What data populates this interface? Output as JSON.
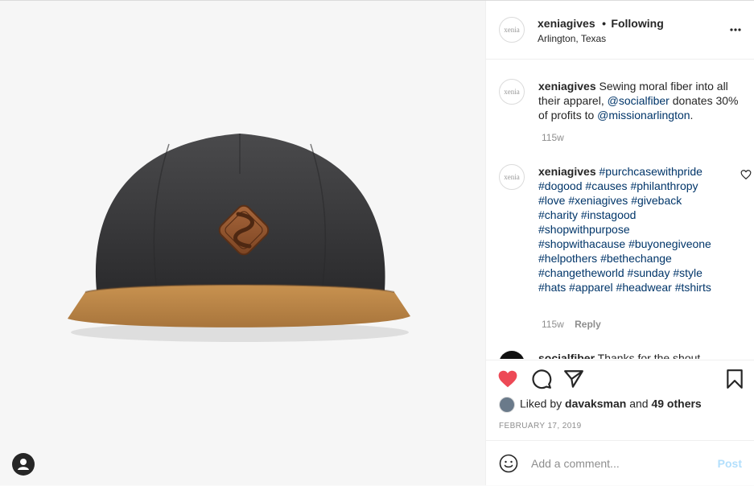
{
  "header": {
    "avatar_text": "xenia",
    "username": "xeniagives",
    "separator": "•",
    "follow_status": "Following",
    "location": "Arlington, Texas"
  },
  "comments": [
    {
      "avatar_text": "xenia",
      "username": "xeniagives",
      "parts": [
        "Sewing moral fiber into all their apparel, ",
        "@socialfiber",
        " donates 30% of profits to ",
        "@missionarlington",
        "."
      ],
      "age": "115w"
    },
    {
      "avatar_text": "xenia",
      "username": "xeniagives",
      "hashtags": [
        "#purchcasewithpride",
        "#dogood",
        "#causes",
        "#philanthropy",
        "#love",
        "#xeniagives",
        "#giveback",
        "#charity",
        "#instagood",
        "#shopwithpurpose",
        "#shopwithacause",
        "#buyonegiveone",
        "#helpothers",
        "#bethechange",
        "#changetheworld",
        "#sunday",
        "#style",
        "#hats",
        "#apparel",
        "#headwear",
        "#tshirts"
      ],
      "age": "115w",
      "reply_label": "Reply"
    },
    {
      "username": "socialfiber",
      "text": "Thanks for the shout"
    }
  ],
  "likes": {
    "prefix": "Liked by ",
    "user": "davaksman",
    "middle": " and ",
    "others": "49 others"
  },
  "date": "FEBRUARY 17, 2019",
  "add_comment": {
    "placeholder": "Add a comment...",
    "post_label": "Post"
  },
  "icons": {
    "like": "heart-filled-icon",
    "comment": "comment-icon",
    "share": "share-icon",
    "save": "bookmark-icon",
    "emoji": "emoji-icon",
    "more": "more-options-icon",
    "user_tag": "user-tag-icon"
  },
  "colors": {
    "like_red": "#ed4956",
    "link_blue": "#003569",
    "post_disabled": "#b2dffc",
    "muted": "#8e8e8e"
  }
}
